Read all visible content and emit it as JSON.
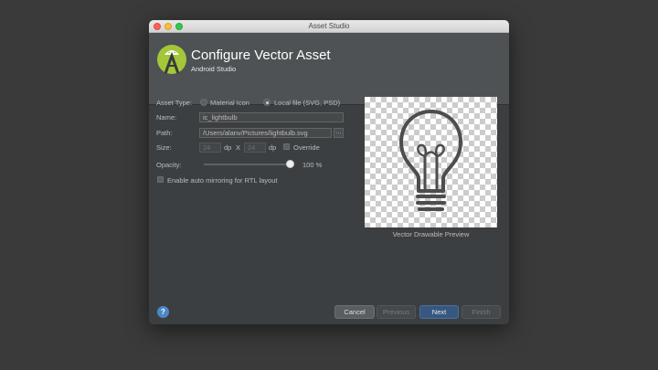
{
  "window": {
    "title": "Asset Studio"
  },
  "header": {
    "title": "Configure Vector Asset",
    "subtitle": "Android Studio"
  },
  "form": {
    "asset_type_label": "Asset Type:",
    "asset_type_options": [
      "Material Icon",
      "Local file (SVG, PSD)"
    ],
    "asset_type_selected": "Local file (SVG, PSD)",
    "name_label": "Name:",
    "name_value": "ic_lightbulb",
    "path_label": "Path:",
    "path_value": "/Users/alanv/Pictures/lightbulb.svg",
    "browse_label": "...",
    "size_label": "Size:",
    "width_value": "24",
    "height_value": "24",
    "unit_dp": "dp",
    "size_separator": "X",
    "override_label": "Override",
    "opacity_label": "Opacity:",
    "opacity_value": 100,
    "opacity_text": "100 %",
    "rtl_label": "Enable auto mirroring for RTL layout"
  },
  "preview": {
    "label": "Vector Drawable Preview"
  },
  "footer": {
    "help_label": "?",
    "cancel_label": "Cancel",
    "previous_label": "Previous",
    "next_label": "Next",
    "finish_label": "Finish"
  },
  "colors": {
    "dialog_bg": "#3c3f41",
    "header_bg": "#4e5254",
    "accent_button": "#365880",
    "help_icon": "#4a88c7",
    "android_green": "#a4c639"
  }
}
